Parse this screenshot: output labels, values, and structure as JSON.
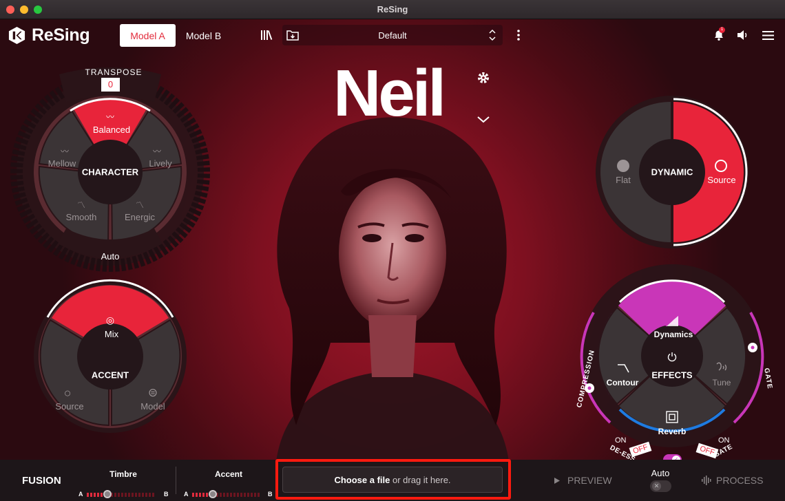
{
  "window": {
    "title": "ReSing"
  },
  "header": {
    "app_name": "ReSing",
    "tabs": [
      {
        "label": "Model A",
        "active": true
      },
      {
        "label": "Model B",
        "active": false
      }
    ],
    "preset": "Default",
    "notification_count": "1"
  },
  "singer": {
    "name": "Neil"
  },
  "character": {
    "transpose_label": "TRANSPOSE",
    "transpose_value": "0",
    "center": "CHARACTER",
    "segments": {
      "top": "Balanced",
      "left": "Mellow",
      "right": "Lively",
      "bottom_left": "Smooth",
      "bottom_right": "Energic"
    },
    "selected": "Balanced",
    "footer": "Auto"
  },
  "accent": {
    "center": "ACCENT",
    "segments": {
      "top": "Mix",
      "left": "Source",
      "right": "Model"
    },
    "selected": "Mix"
  },
  "dynamic": {
    "center": "DYNAMIC",
    "segments": {
      "left": "Flat",
      "right": "Source"
    },
    "selected": "Source"
  },
  "effects": {
    "center": "EFFECTS",
    "segments": {
      "top": "Dynamics",
      "left": "Contour",
      "right": "Tune",
      "bottom": "Reverb"
    },
    "selected": "Dynamics",
    "arc_labels": {
      "left": "COMPRESSION",
      "right": "GATE"
    },
    "de_ess": {
      "label": "DE-ESS",
      "on": "ON",
      "off": "OFF"
    },
    "gate": {
      "label": "GATE",
      "on": "ON",
      "off": "OFF"
    }
  },
  "bottom": {
    "fusion": "FUSION",
    "timbre": {
      "label": "Timbre",
      "start": "A",
      "end": "B",
      "value": 0.3
    },
    "accent": {
      "label": "Accent",
      "start": "A",
      "end": "B",
      "value": 0.3
    },
    "dropzone": {
      "bold": "Choose a file",
      "rest": " or drag it here."
    },
    "preview": "PREVIEW",
    "auto": "Auto",
    "process": "PROCESS"
  },
  "colors": {
    "accent_red": "#e8243a",
    "magenta": "#c936b8",
    "blue": "#1e7be0",
    "purple": "#7b4fd0",
    "segment_gray": "#3b3436",
    "hub_dark": "#24161a"
  },
  "icons": [
    "logo-icon",
    "library-icon",
    "folder-icon",
    "chevron-updown-icon",
    "more-vertical-icon",
    "settings-gear-icon",
    "chevron-down-icon",
    "bell-icon",
    "speaker-icon",
    "menu-icon",
    "wave-icon",
    "power-icon",
    "play-icon",
    "waveform-icon"
  ]
}
